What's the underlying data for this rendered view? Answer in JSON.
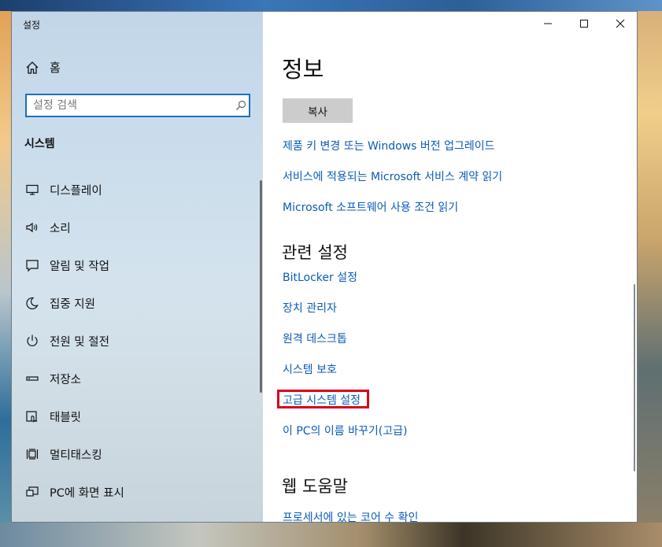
{
  "window": {
    "title": "설정",
    "controls": {
      "minimize": "minimize",
      "maximize": "maximize",
      "close": "close"
    }
  },
  "sidebar": {
    "home_label": "홈",
    "search_placeholder": "설정 검색",
    "section_label": "시스템",
    "items": [
      {
        "label": "디스플레이",
        "icon": "display-icon"
      },
      {
        "label": "소리",
        "icon": "speaker-icon"
      },
      {
        "label": "알림 및 작업",
        "icon": "notification-icon"
      },
      {
        "label": "집중 지원",
        "icon": "moon-icon"
      },
      {
        "label": "전원 및 절전",
        "icon": "power-icon"
      },
      {
        "label": "저장소",
        "icon": "storage-icon"
      },
      {
        "label": "태블릿",
        "icon": "tablet-icon"
      },
      {
        "label": "멀티태스킹",
        "icon": "multitasking-icon"
      },
      {
        "label": "PC에 화면 표시",
        "icon": "project-icon"
      }
    ]
  },
  "main": {
    "title": "정보",
    "copy_button": "복사",
    "links": [
      "제품 키 변경 또는 Windows 버전 업그레이드",
      "서비스에 적용되는 Microsoft 서비스 계약 읽기",
      "Microsoft 소프트웨어 사용 조건 읽기"
    ],
    "related_heading": "관련 설정",
    "related_links": [
      "BitLocker 설정",
      "장치 관리자",
      "원격 데스크톱",
      "시스템 보호",
      "고급 시스템 설정",
      "이 PC의 이름 바꾸기(고급)"
    ],
    "help_heading": "웹 도움말",
    "help_links": [
      "프로세서에 있는 코어 수 확인"
    ]
  },
  "colors": {
    "link": "#0a5bb5",
    "highlight": "#d9001b",
    "accent": "#1f6fb5"
  }
}
